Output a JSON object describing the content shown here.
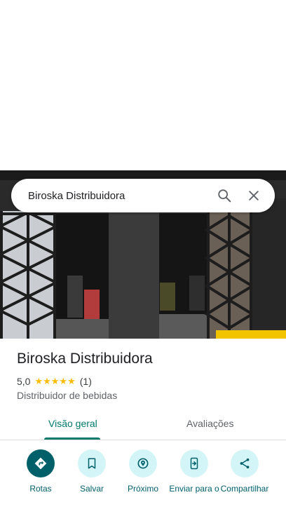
{
  "search": {
    "query": "Biroska Distribuidora",
    "icons": [
      "search-icon",
      "close-icon"
    ]
  },
  "place": {
    "title": "Biroska Distribuidora",
    "rating": "5,0",
    "stars": "★★★★★",
    "review_count": "(1)",
    "category": "Distribuidor de bebidas"
  },
  "tabs": [
    {
      "label": "Visão geral",
      "active": true
    },
    {
      "label": "Avaliações",
      "active": false
    }
  ],
  "actions": [
    {
      "label": "Rotas",
      "icon": "directions-icon"
    },
    {
      "label": "Salvar",
      "icon": "bookmark-icon"
    },
    {
      "label": "Próximo",
      "icon": "nearby-icon"
    },
    {
      "label": "Enviar para o",
      "icon": "send-to-phone-icon"
    },
    {
      "label": "Compartilhar",
      "icon": "share-icon"
    }
  ],
  "colors": {
    "accent": "#00796b",
    "action_bg": "#d4f5f7",
    "action_primary": "#00606a",
    "star": "#fbbc04"
  }
}
